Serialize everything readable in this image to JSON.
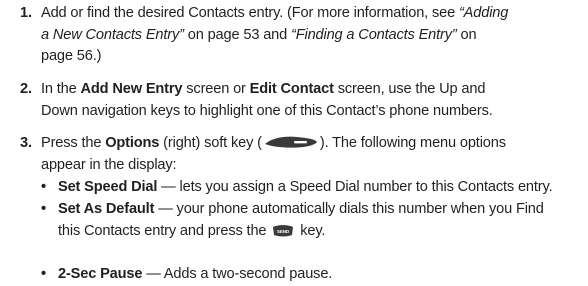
{
  "steps": [
    {
      "number": "1.",
      "lines": [
        {
          "a": "Add or find the desired Contacts entry. (For more information, see ",
          "b": "“Adding"
        },
        {
          "a": "a New Contacts Entry”",
          "b": " on page 53 and ",
          "c": "“Finding a Contacts Entry”",
          "d": " on"
        },
        {
          "a": "page 56.)"
        }
      ]
    },
    {
      "number": "2.",
      "lines": [
        {
          "a": "In the ",
          "b": "Add New Entry",
          "c": " screen or ",
          "d": "Edit Contact",
          "e": " screen, use the Up and"
        },
        {
          "a": "Down navigation keys to highlight one of this Contact’s phone numbers."
        }
      ]
    },
    {
      "number": "3.",
      "lines": [
        {
          "a": "Press the ",
          "b": "Options",
          "c": " (right) soft key (",
          "d": "). The following menu options"
        },
        {
          "a": "appear in the display:"
        }
      ]
    }
  ],
  "bullets": [
    {
      "glyph": "•",
      "title": "Set Speed Dial",
      "text": " — lets you assign a Speed Dial number to this Contacts entry."
    },
    {
      "glyph": "•",
      "title": "Set As Default",
      "text": " — your phone automatically dials this number when you Find",
      "text2a": "this Contacts entry and press the ",
      "text2b": " key."
    },
    {
      "glyph": "•",
      "title": "2-Sec Pause",
      "text": " — Adds a two-second pause."
    }
  ],
  "icons": {
    "softkey": "right-soft-key-icon",
    "sendkey": "send-key-icon",
    "sendkey_label": "SEND"
  },
  "colors": {
    "text": "#231f20",
    "key_body": "#3a3a3a"
  }
}
